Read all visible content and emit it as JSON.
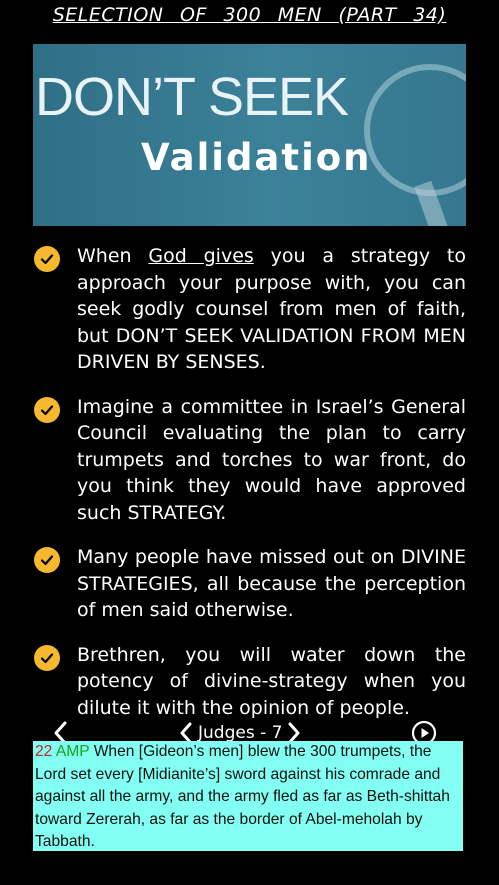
{
  "title": "SELECTION   OF   300 MEN   (PART 34)",
  "banner": {
    "line1": "DON’T SEEK",
    "line2": "Validation"
  },
  "points": [
    {
      "before": "When ",
      "link": "God gives",
      "after": "  you a strategy to approach your purpose with, you can seek godly counsel from men of faith, but DON’T SEEK VALIDATION FROM MEN DRIVEN BY SENSES."
    },
    {
      "text": "Imagine a committee in Israel’s General Council evaluating the plan to carry trumpets and torches to war front, do you think they would have approved such STRATEGY."
    },
    {
      "text": "Many people have missed out on DIVINE STRATEGIES, all because the perception of men said otherwise."
    },
    {
      "text": "Brethren, you will water down the potency of divine-strategy when you dilute it with the opinion of people."
    }
  ],
  "nav": {
    "chapter": "Judges - 7"
  },
  "verse": {
    "number": "22",
    "version": "AMP",
    "text": "When [Gideon’s men] blew the 300 trumpets, the Lord set every [Midianite’s] sword against his comrade and against all the army, and the army fled as far as Beth-shittah toward Zererah, as far as the border of Abel-meholah by Tabbath."
  },
  "colors": {
    "check": "#f5b82e",
    "verse_bg": "#82fff2",
    "banner": "#3b8198"
  }
}
